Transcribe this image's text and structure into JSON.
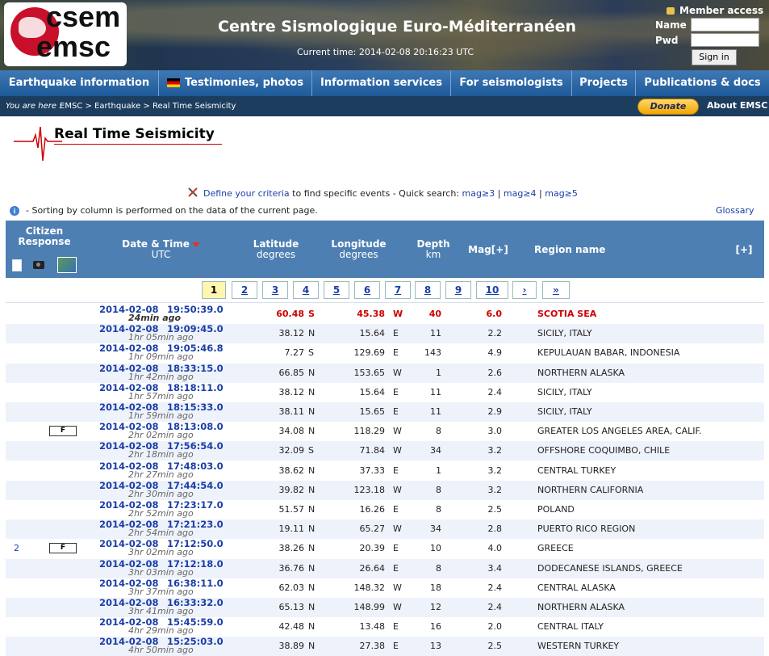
{
  "header": {
    "logo_line1": "csem",
    "logo_line2": "emsc",
    "site_title": "Centre Sismologique Euro-Méditerranéen",
    "current_time": "Current time: 2014-02-08 20:16:23 UTC",
    "member_access": "Member access",
    "name_label": "Name",
    "pwd_label": "Pwd",
    "signin_label": "Sign in"
  },
  "nav": {
    "items": [
      "Earthquake information",
      "Testimonies, photos",
      "Information services",
      "For seismologists",
      "Projects",
      "Publications & docs"
    ]
  },
  "breadcrumb": {
    "you_are_here": "You are here :",
    "path": "EMSC > Earthquake > Real Time Seismicity",
    "donate": "Donate",
    "about": "About EMSC"
  },
  "page": {
    "title": "Real Time Seismicity",
    "criteria_link": "Define your criteria",
    "criteria_text": " to find specific events - Quick search: ",
    "mag3": "mag≥3",
    "mag4": "mag≥4",
    "mag5": "mag≥5",
    "pipe": " | ",
    "sort_info": "- Sorting by column is performed on the data of the current page.",
    "glossary": "Glossary"
  },
  "table": {
    "headers": {
      "citizen": "Citizen Response",
      "datetime": "Date & Time",
      "datetime_sub": "UTC",
      "lat": "Latitude",
      "lat_sub": "degrees",
      "lon": "Longitude",
      "lon_sub": "degrees",
      "depth": "Depth",
      "depth_sub": "km",
      "mag": "Mag[+]",
      "region": "Region name",
      "expand": "[+]"
    },
    "pages": [
      "1",
      "2",
      "3",
      "4",
      "5",
      "6",
      "7",
      "8",
      "9",
      "10",
      "›",
      "»"
    ],
    "rows": [
      {
        "date": "2014-02-08",
        "time": "19:50:39.0",
        "ago": "24min ago",
        "lat": "60.48",
        "ns": "S",
        "lon": "45.38",
        "ew": "W",
        "depth": "40",
        "mag": "6.0",
        "region": "SCOTIA SEA",
        "felt": "",
        "count": ""
      },
      {
        "date": "2014-02-08",
        "time": "19:09:45.0",
        "ago": "1hr 05min ago",
        "lat": "38.12",
        "ns": "N",
        "lon": "15.64",
        "ew": "E",
        "depth": "11",
        "mag": "2.2",
        "region": "SICILY, ITALY",
        "felt": "",
        "count": ""
      },
      {
        "date": "2014-02-08",
        "time": "19:05:46.8",
        "ago": "1hr 09min ago",
        "lat": "7.27",
        "ns": "S",
        "lon": "129.69",
        "ew": "E",
        "depth": "143",
        "mag": "4.9",
        "region": "KEPULAUAN BABAR, INDONESIA",
        "felt": "",
        "count": ""
      },
      {
        "date": "2014-02-08",
        "time": "18:33:15.0",
        "ago": "1hr 42min ago",
        "lat": "66.85",
        "ns": "N",
        "lon": "153.65",
        "ew": "W",
        "depth": "1",
        "mag": "2.6",
        "region": "NORTHERN ALASKA",
        "felt": "",
        "count": ""
      },
      {
        "date": "2014-02-08",
        "time": "18:18:11.0",
        "ago": "1hr 57min ago",
        "lat": "38.12",
        "ns": "N",
        "lon": "15.64",
        "ew": "E",
        "depth": "11",
        "mag": "2.4",
        "region": "SICILY, ITALY",
        "felt": "",
        "count": ""
      },
      {
        "date": "2014-02-08",
        "time": "18:15:33.0",
        "ago": "1hr 59min ago",
        "lat": "38.11",
        "ns": "N",
        "lon": "15.65",
        "ew": "E",
        "depth": "11",
        "mag": "2.9",
        "region": "SICILY, ITALY",
        "felt": "",
        "count": ""
      },
      {
        "date": "2014-02-08",
        "time": "18:13:08.0",
        "ago": "2hr 02min ago",
        "lat": "34.08",
        "ns": "N",
        "lon": "118.29",
        "ew": "W",
        "depth": "8",
        "mag": "3.0",
        "region": "GREATER LOS ANGELES AREA, CALIF.",
        "felt": "F",
        "count": ""
      },
      {
        "date": "2014-02-08",
        "time": "17:56:54.0",
        "ago": "2hr 18min ago",
        "lat": "32.09",
        "ns": "S",
        "lon": "71.84",
        "ew": "W",
        "depth": "34",
        "mag": "3.2",
        "region": "OFFSHORE COQUIMBO, CHILE",
        "felt": "",
        "count": ""
      },
      {
        "date": "2014-02-08",
        "time": "17:48:03.0",
        "ago": "2hr 27min ago",
        "lat": "38.62",
        "ns": "N",
        "lon": "37.33",
        "ew": "E",
        "depth": "1",
        "mag": "3.2",
        "region": "CENTRAL TURKEY",
        "felt": "",
        "count": ""
      },
      {
        "date": "2014-02-08",
        "time": "17:44:54.0",
        "ago": "2hr 30min ago",
        "lat": "39.82",
        "ns": "N",
        "lon": "123.18",
        "ew": "W",
        "depth": "8",
        "mag": "3.2",
        "region": "NORTHERN CALIFORNIA",
        "felt": "",
        "count": ""
      },
      {
        "date": "2014-02-08",
        "time": "17:23:17.0",
        "ago": "2hr 52min ago",
        "lat": "51.57",
        "ns": "N",
        "lon": "16.26",
        "ew": "E",
        "depth": "8",
        "mag": "2.5",
        "region": "POLAND",
        "felt": "",
        "count": ""
      },
      {
        "date": "2014-02-08",
        "time": "17:21:23.0",
        "ago": "2hr 54min ago",
        "lat": "19.11",
        "ns": "N",
        "lon": "65.27",
        "ew": "W",
        "depth": "34",
        "mag": "2.8",
        "region": "PUERTO RICO REGION",
        "felt": "",
        "count": ""
      },
      {
        "date": "2014-02-08",
        "time": "17:12:50.0",
        "ago": "3hr 02min ago",
        "lat": "38.26",
        "ns": "N",
        "lon": "20.39",
        "ew": "E",
        "depth": "10",
        "mag": "4.0",
        "region": "GREECE",
        "felt": "F",
        "count": "2"
      },
      {
        "date": "2014-02-08",
        "time": "17:12:18.0",
        "ago": "3hr 03min ago",
        "lat": "36.76",
        "ns": "N",
        "lon": "26.64",
        "ew": "E",
        "depth": "8",
        "mag": "3.4",
        "region": "DODECANESE ISLANDS, GREECE",
        "felt": "",
        "count": ""
      },
      {
        "date": "2014-02-08",
        "time": "16:38:11.0",
        "ago": "3hr 37min ago",
        "lat": "62.03",
        "ns": "N",
        "lon": "148.32",
        "ew": "W",
        "depth": "18",
        "mag": "2.4",
        "region": "CENTRAL ALASKA",
        "felt": "",
        "count": ""
      },
      {
        "date": "2014-02-08",
        "time": "16:33:32.0",
        "ago": "3hr 41min ago",
        "lat": "65.13",
        "ns": "N",
        "lon": "148.99",
        "ew": "W",
        "depth": "12",
        "mag": "2.4",
        "region": "NORTHERN ALASKA",
        "felt": "",
        "count": ""
      },
      {
        "date": "2014-02-08",
        "time": "15:45:59.0",
        "ago": "4hr 29min ago",
        "lat": "42.48",
        "ns": "N",
        "lon": "13.48",
        "ew": "E",
        "depth": "16",
        "mag": "2.0",
        "region": "CENTRAL ITALY",
        "felt": "",
        "count": ""
      },
      {
        "date": "2014-02-08",
        "time": "15:25:03.0",
        "ago": "4hr 50min ago",
        "lat": "38.89",
        "ns": "N",
        "lon": "27.38",
        "ew": "E",
        "depth": "13",
        "mag": "2.5",
        "region": "WESTERN TURKEY",
        "felt": "",
        "count": ""
      }
    ]
  }
}
